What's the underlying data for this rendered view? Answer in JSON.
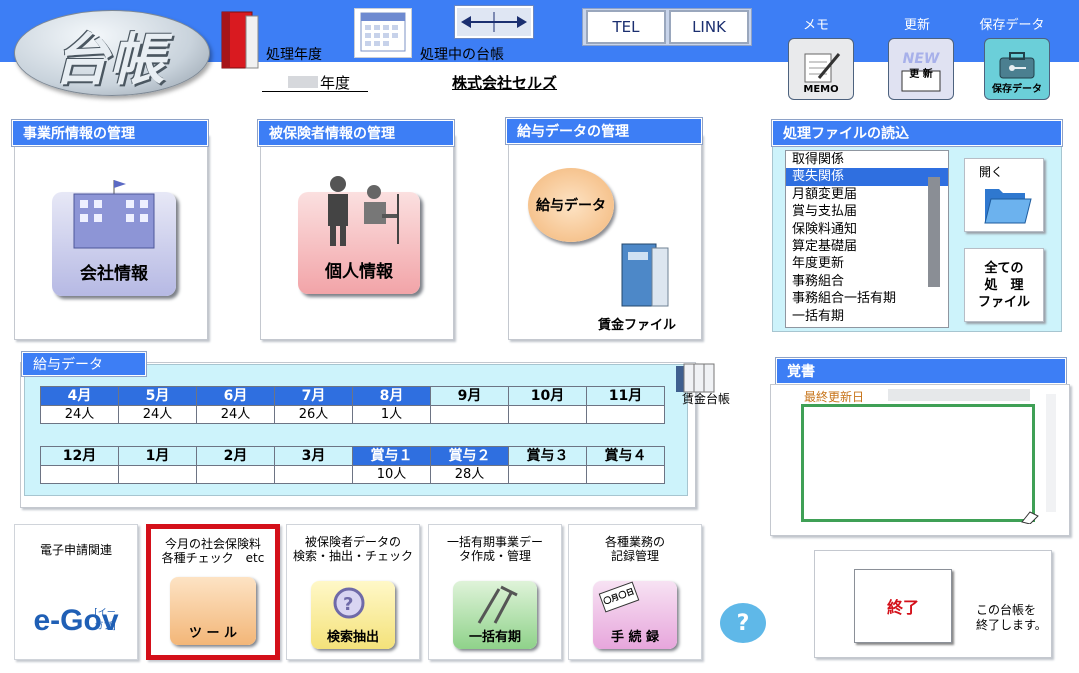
{
  "header": {
    "logo_text": "台帳",
    "fiscal_year_label": "処理年度",
    "current_ledger_label": "処理中の台帳",
    "year_suffix": "年度",
    "company_name": "株式会社セルズ",
    "tel_label": "TEL",
    "link_label": "LINK",
    "memo_caption": "メモ",
    "memo_icon_text": "MEMO",
    "update_caption": "更新",
    "update_icon_text": "更 新",
    "update_icon_badge": "NEW",
    "save_caption": "保存データ",
    "save_icon_text": "保存データ"
  },
  "sections": {
    "office": {
      "title": "事業所情報の管理",
      "button_label": "会社情報"
    },
    "insured": {
      "title": "被保険者情報の管理",
      "button_label": "個人情報"
    },
    "salary": {
      "title": "給与データの管理",
      "button_label": "給与データ",
      "file_label": "賃金ファイル"
    }
  },
  "process_files": {
    "title": "処理ファイルの読込",
    "items": [
      "取得関係",
      "喪失関係",
      "月額変更届",
      "賞与支払届",
      "保険料通知",
      "算定基礎届",
      "年度更新",
      "事務組合",
      "事務組合一括有期",
      "一括有期"
    ],
    "selected_index": 1,
    "open_label": "開く",
    "all_files_label_1": "全ての",
    "all_files_label_2": "処　理",
    "all_files_label_3": "ファイル"
  },
  "salary_data": {
    "title": "給与データ",
    "ledger_label": "賃金台帳",
    "row1": {
      "months": [
        "4月",
        "5月",
        "6月",
        "7月",
        "8月",
        "9月",
        "10月",
        "11月"
      ],
      "counts": [
        "24人",
        "24人",
        "24人",
        "26人",
        "1人",
        "",
        "",
        ""
      ],
      "active": [
        true,
        true,
        true,
        true,
        true,
        false,
        false,
        false
      ]
    },
    "row2": {
      "months": [
        "12月",
        "1月",
        "2月",
        "3月",
        "賞与１",
        "賞与２",
        "賞与３",
        "賞与４"
      ],
      "counts": [
        "",
        "",
        "",
        "",
        "10人",
        "28人",
        "",
        ""
      ],
      "active": [
        false,
        false,
        false,
        false,
        true,
        true,
        false,
        false
      ]
    }
  },
  "memo": {
    "title": "覚書",
    "last_updated_label": "最終更新日"
  },
  "tools": {
    "egov": {
      "caption": "電子申請関連",
      "logo_text": "e-Gov",
      "logo_sub": "[イーガブ]"
    },
    "check": {
      "caption_1": "今月の社会保険料",
      "caption_2": "各種チェック　etc",
      "button_label": "ツ ー ル"
    },
    "search": {
      "caption_1": "被保険者データの",
      "caption_2": "検索・抽出・チェック",
      "button_label": "検索抽出"
    },
    "lumpsum": {
      "caption_1": "一括有期事業デー",
      "caption_2": "タ作成・管理",
      "button_label": "一括有期"
    },
    "records": {
      "caption_1": "各種業務の",
      "caption_2": "記録管理",
      "button_label": "手 続 録",
      "stamp_text": "〇月〇日"
    }
  },
  "help_label": "?",
  "exit": {
    "button_label": "終了",
    "description_1": "この台帳を",
    "description_2": "終了します。"
  },
  "colors": {
    "accent": "#3d7ef5",
    "panel_bg": "#cdf3fb",
    "highlight": "#d4101a"
  }
}
